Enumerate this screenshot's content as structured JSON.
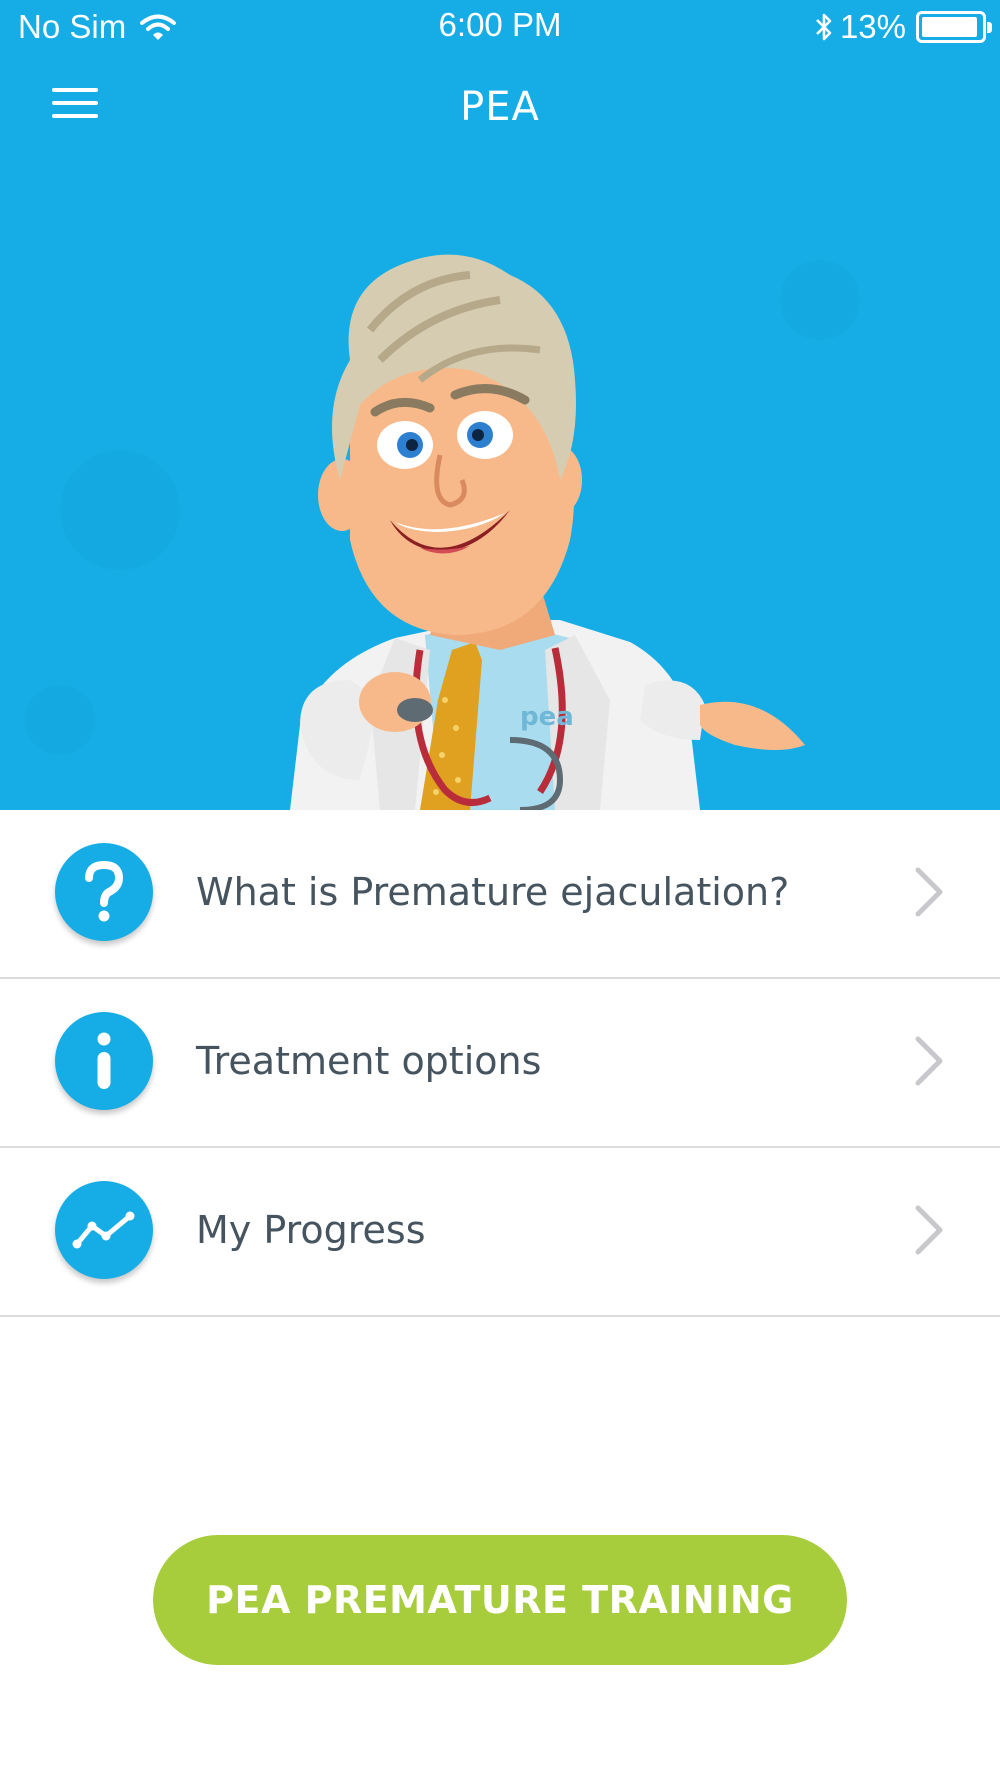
{
  "status_bar": {
    "carrier": "No Sim",
    "time": "6:00 PM",
    "battery_percent_text": "13%",
    "battery_level": 0.95
  },
  "nav": {
    "title": "PEA",
    "menu_icon": "hamburger-icon"
  },
  "hero": {
    "coat_logo": "pea"
  },
  "menu": [
    {
      "label": "What is Premature ejaculation?",
      "icon": "question-icon"
    },
    {
      "label": "Treatment options",
      "icon": "info-icon"
    },
    {
      "label": "My Progress",
      "icon": "progress-chart-icon"
    }
  ],
  "training_button": {
    "label": "PEA PREMATURE TRAINING"
  },
  "colors": {
    "primary_blue": "#16ade6",
    "button_green": "#a8cd3c",
    "text_dark": "#45545f",
    "chevron_gray": "#c8c8cc"
  }
}
